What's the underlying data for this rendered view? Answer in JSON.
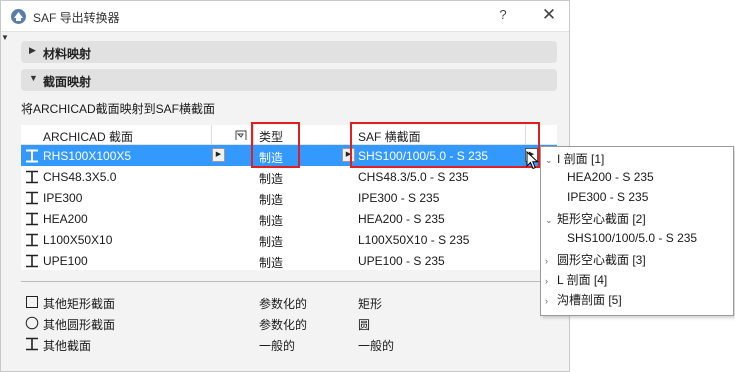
{
  "window": {
    "title": "SAF 导出转换器",
    "help_label": "?",
    "close_label": "✕"
  },
  "sections": [
    {
      "label": "材料映射",
      "expanded": false
    },
    {
      "label": "截面映射",
      "expanded": true
    }
  ],
  "caption": "将ARCHICAD截面映射到SAF横截面",
  "table": {
    "columns": {
      "archicad": "ARCHICAD 截面",
      "type": "类型",
      "saf": "SAF 横截面"
    },
    "rows": [
      {
        "name": "RHS100X100X5",
        "type": "制造",
        "saf": "SHS100/100/5.0 - S 235",
        "selected": true
      },
      {
        "name": "CHS48.3X5.0",
        "type": "制造",
        "saf": "CHS48.3/5.0 - S 235"
      },
      {
        "name": "IPE300",
        "type": "制造",
        "saf": "IPE300 - S 235"
      },
      {
        "name": "HEA200",
        "type": "制造",
        "saf": "HEA200 - S 235"
      },
      {
        "name": "L100X50X10",
        "type": "制造",
        "saf": "L100X50X10 - S 235"
      },
      {
        "name": "UPE100",
        "type": "制造",
        "saf": "UPE100 - S 235"
      }
    ]
  },
  "defaults": [
    {
      "name": "其他矩形截面",
      "type": "参数化的",
      "saf": "矩形"
    },
    {
      "name": "其他圆形截面",
      "type": "参数化的",
      "saf": "圆"
    },
    {
      "name": "其他截面",
      "type": "一般的",
      "saf": "一般的"
    }
  ],
  "popup": {
    "items": [
      {
        "label": "I 剖面 [1]",
        "group": true,
        "expanded": true
      },
      {
        "label": "HEA200 - S 235",
        "group": false
      },
      {
        "label": "IPE300 - S 235",
        "group": false
      },
      {
        "label": "矩形空心截面 [2]",
        "group": true,
        "expanded": true
      },
      {
        "label": "SHS100/100/5.0 - S 235",
        "group": false
      },
      {
        "label": "圆形空心截面 [3]",
        "group": true,
        "expanded": false
      },
      {
        "label": "L 剖面 [4]",
        "group": true,
        "expanded": false
      },
      {
        "label": "沟槽剖面 [5]",
        "group": true,
        "expanded": false
      }
    ]
  },
  "colors": {
    "selection": "#3399ff",
    "highlight": "#e02020"
  }
}
